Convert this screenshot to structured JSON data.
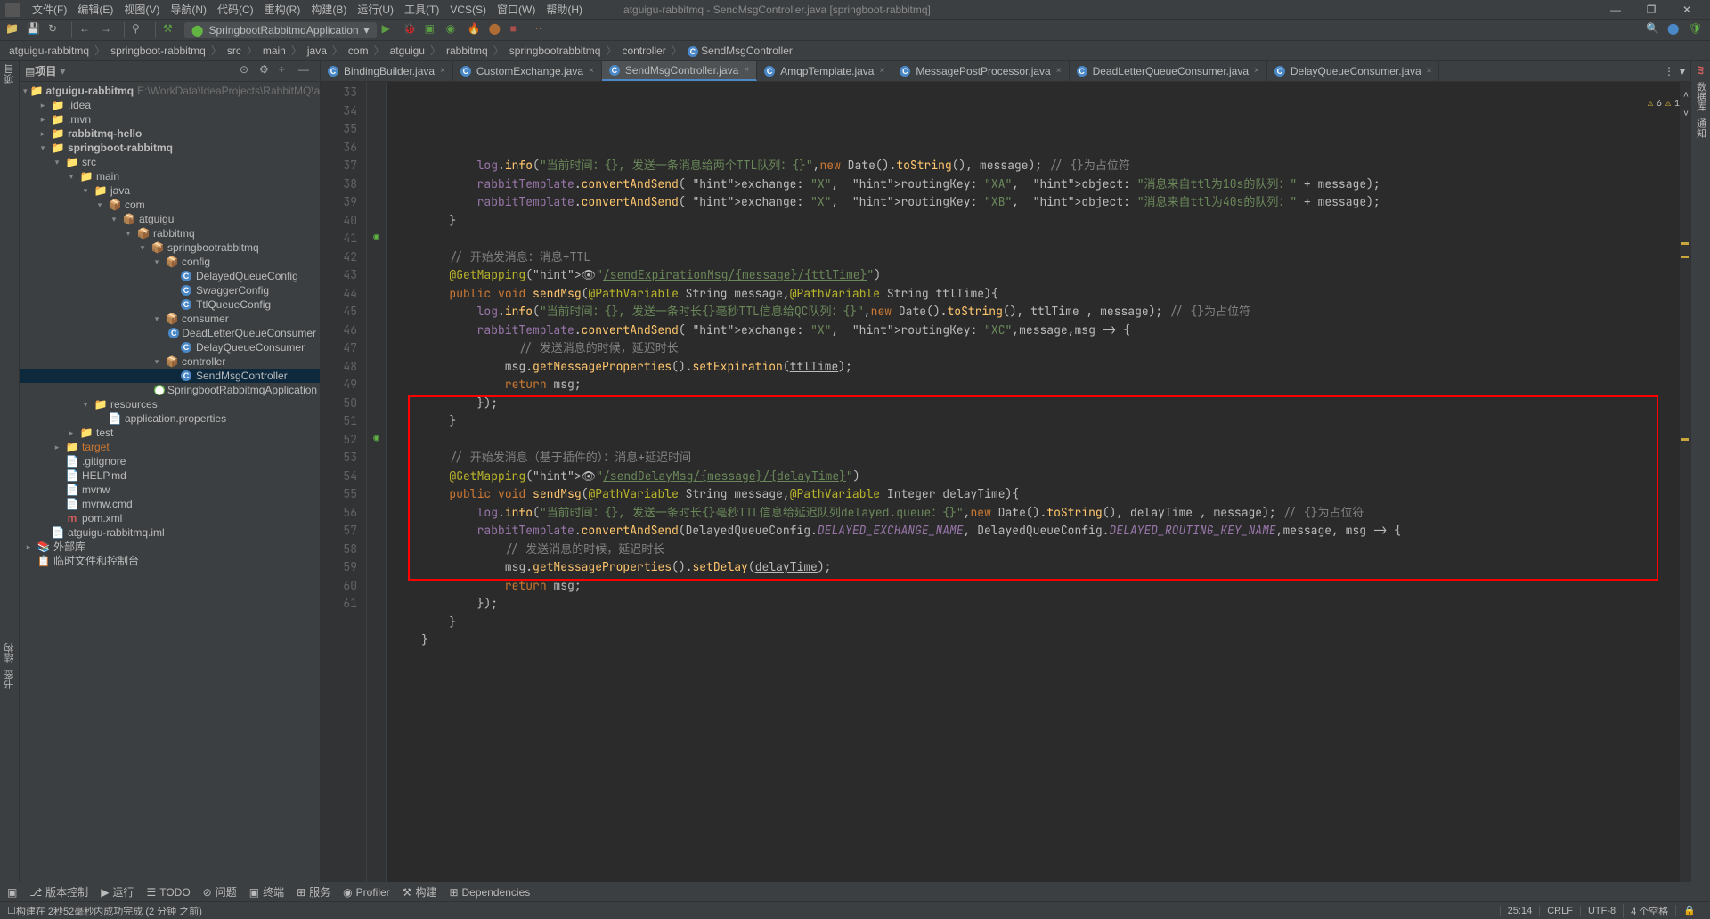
{
  "window": {
    "title": "atguigu-rabbitmq - SendMsgController.java [springboot-rabbitmq]"
  },
  "menu": {
    "file": "文件(F)",
    "edit": "编辑(E)",
    "view": "视图(V)",
    "navigate": "导航(N)",
    "code": "代码(C)",
    "refactor": "重构(R)",
    "build": "构建(B)",
    "run": "运行(U)",
    "tools": "工具(T)",
    "vcs": "VCS(S)",
    "window": "窗口(W)",
    "help": "帮助(H)"
  },
  "run_config": {
    "label": "SpringbootRabbitmqApplication"
  },
  "breadcrumbs": [
    "atguigu-rabbitmq",
    "springboot-rabbitmq",
    "src",
    "main",
    "java",
    "com",
    "atguigu",
    "rabbitmq",
    "springbootrabbitmq",
    "controller",
    "SendMsgController"
  ],
  "left_vtabs": {
    "project": "项目",
    "structure": "结构",
    "bookmarks": "书签"
  },
  "right_vtabs": {
    "maven": "m",
    "database": "数据库",
    "notifications": "通知"
  },
  "project_panel": {
    "title": "项目",
    "root_path": "E:\\WorkData\\IdeaProjects\\RabbitMQ\\at"
  },
  "tree": {
    "root": "atguigu-rabbitmq",
    "idea": ".idea",
    "mvn": ".mvn",
    "hello": "rabbitmq-hello",
    "sb": "springboot-rabbitmq",
    "src": "src",
    "main": "main",
    "java": "java",
    "com": "com",
    "atguigu": "atguigu",
    "rabbitmq": "rabbitmq",
    "sbrmq": "springbootrabbitmq",
    "config": "config",
    "DelayedQueueConfig": "DelayedQueueConfig",
    "SwaggerConfig": "SwaggerConfig",
    "TtlQueueConfig": "TtlQueueConfig",
    "consumer": "consumer",
    "DeadLetterQueueConsumer": "DeadLetterQueueConsumer",
    "DelayQueueConsumer": "DelayQueueConsumer",
    "controller": "controller",
    "SendMsgController": "SendMsgController",
    "SpringbootRabbitmqApplication": "SpringbootRabbitmqApplication",
    "resources": "resources",
    "appprops": "application.properties",
    "test": "test",
    "target": "target",
    "gitignore": ".gitignore",
    "helpmd": "HELP.md",
    "mvnw": "mvnw",
    "mvnwcmd": "mvnw.cmd",
    "pomxml": "pom.xml",
    "iml": "atguigu-rabbitmq.iml",
    "extlibs": "外部库",
    "scratches": "临时文件和控制台"
  },
  "tabs": [
    {
      "label": "BindingBuilder.java",
      "icon": "cls"
    },
    {
      "label": "CustomExchange.java",
      "icon": "cls"
    },
    {
      "label": "SendMsgController.java",
      "icon": "cls",
      "active": true
    },
    {
      "label": "AmqpTemplate.java",
      "icon": "cls"
    },
    {
      "label": "MessagePostProcessor.java",
      "icon": "cls"
    },
    {
      "label": "DeadLetterQueueConsumer.java",
      "icon": "cls"
    },
    {
      "label": "DelayQueueConsumer.java",
      "icon": "cls"
    }
  ],
  "inspection": {
    "warnings": "6",
    "weak": "1"
  },
  "code": {
    "line_start": 33,
    "line_end": 61,
    "lines": [
      "",
      "            log.info(\"当前时间：{}, 发送一条消息给两个TTL队列：{}\",new Date().toString(), message); // {}为占位符",
      "            rabbitTemplate.convertAndSend( exchange: \"X\",  routingKey: \"XA\",  object: \"消息来自ttl为10s的队列：\" + message);",
      "            rabbitTemplate.convertAndSend( exchange: \"X\",  routingKey: \"XB\",  object: \"消息来自ttl为40s的队列：\" + message);",
      "        }",
      "",
      "        // 开始发消息：消息+TTL",
      "        @GetMapping(👁\"/sendExpirationMsg/{message}/{ttlTime}\")",
      "        public void sendMsg(@PathVariable String message,@PathVariable String ttlTime){",
      "            log.info(\"当前时间：{}, 发送一条时长{}毫秒TTL信息给QC队列：{}\",new Date().toString(), ttlTime , message); // {}为占位符",
      "            rabbitTemplate.convertAndSend( exchange: \"X\",  routingKey: \"XC\",message,msg -> {",
      "                  // 发送消息的时候，延迟时长",
      "                msg.getMessageProperties().setExpiration(ttlTime);",
      "                return msg;",
      "            });",
      "        }",
      "",
      "        // 开始发消息（基于插件的）：消息+延迟时间",
      "        @GetMapping(👁\"/sendDelayMsg/{message}/{delayTime}\")",
      "        public void sendMsg(@PathVariable String message,@PathVariable Integer delayTime){",
      "            log.info(\"当前时间：{}, 发送一条时长{}毫秒TTL信息给延迟队列delayed.queue：{}\",new Date().toString(), delayTime , message); // {}为占位符",
      "            rabbitTemplate.convertAndSend(DelayedQueueConfig.DELAYED_EXCHANGE_NAME, DelayedQueueConfig.DELAYED_ROUTING_KEY_NAME,message, msg -> {",
      "                // 发送消息的时候，延迟时长",
      "                msg.getMessageProperties().setDelay(delayTime);",
      "                return msg;",
      "            });",
      "        }",
      "    }",
      ""
    ]
  },
  "bottom_tools": {
    "version": "版本控制",
    "run": "运行",
    "todo": "TODO",
    "problems": "问题",
    "terminal": "终端",
    "services": "服务",
    "profiler": "Profiler",
    "build": "构建",
    "dependencies": "Dependencies"
  },
  "status": {
    "message": "构建在 2秒52毫秒内成功完成 (2 分钟 之前)",
    "pos": "25:14",
    "lineending": "CRLF",
    "encoding": "UTF-8",
    "indent": "4 个空格"
  }
}
